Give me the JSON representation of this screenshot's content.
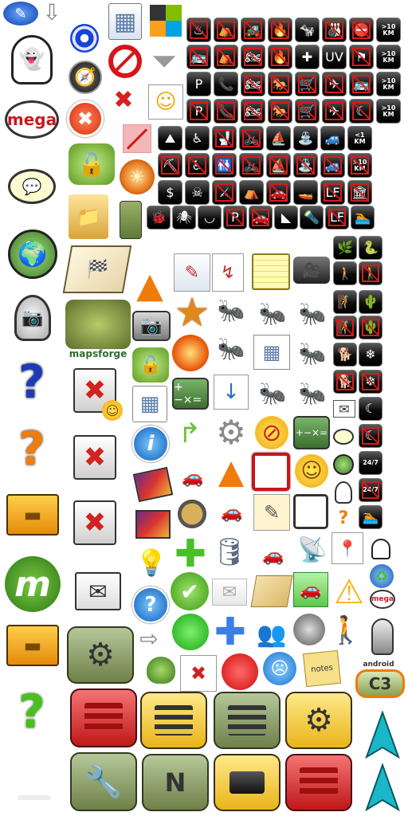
{
  "sheet": {
    "background": "#ffffff"
  },
  "labels": {
    "mega": "mega",
    "mapsforge": "mapsforge",
    "km": "KM",
    "km_prefix_10": ">10",
    "km_prefix_1": "<1",
    "uv": "UV",
    "hours": "24/7",
    "notes": "notes",
    "android": "android",
    "c3": "C3"
  },
  "icons": [
    {
      "name": "geocaching-pen-icon",
      "glyph": "✎"
    },
    {
      "name": "arrow-down-icon",
      "glyph": "⇩"
    },
    {
      "name": "ghost-icon",
      "glyph": "👻"
    },
    {
      "name": "target-icon",
      "glyph": "◎"
    },
    {
      "name": "calculator-list-icon",
      "glyph": "▦"
    },
    {
      "name": "geocaching-logo-icon",
      "glyph": "◩"
    },
    {
      "name": "compass-icon",
      "glyph": "🧭"
    },
    {
      "name": "no-entry-icon",
      "glyph": "⛔"
    },
    {
      "name": "filter-funnel-icon",
      "glyph": "⏷"
    },
    {
      "name": "close-circle-icon",
      "glyph": "✖"
    },
    {
      "name": "red-x-icon",
      "glyph": "✖"
    },
    {
      "name": "note-smiley-icon",
      "glyph": "☺"
    },
    {
      "name": "chat-bubble-icon",
      "glyph": "💬"
    },
    {
      "name": "unlock-icon",
      "glyph": "🔓"
    },
    {
      "name": "red-strike-icon",
      "glyph": "⧄"
    },
    {
      "name": "sun-fire-icon",
      "glyph": "☀"
    },
    {
      "name": "world-map-icon",
      "glyph": "🌍"
    },
    {
      "name": "folder-icon",
      "glyph": "📁"
    },
    {
      "name": "green-card-icon",
      "glyph": "▮"
    },
    {
      "name": "webcam-icon",
      "glyph": "📷"
    },
    {
      "name": "question-blue-icon",
      "glyph": "?"
    },
    {
      "name": "question-orange-icon",
      "glyph": "?"
    },
    {
      "name": "question-green-icon",
      "glyph": "?"
    },
    {
      "name": "orange-boxes-icon",
      "glyph": "▬"
    },
    {
      "name": "m-logo-icon",
      "glyph": "m"
    },
    {
      "name": "envelope-icon",
      "glyph": "✉"
    },
    {
      "name": "gear-icon",
      "glyph": "⚙"
    },
    {
      "name": "arrow-right-icon",
      "glyph": "⇨"
    },
    {
      "name": "map-flag-icon",
      "glyph": "🏁"
    },
    {
      "name": "traffic-cone-icon",
      "glyph": "▲"
    },
    {
      "name": "star-icon",
      "glyph": "★"
    },
    {
      "name": "camera-icon",
      "glyph": "📷"
    },
    {
      "name": "camcorder-icon",
      "glyph": "🎥"
    },
    {
      "name": "notepad-icon",
      "glyph": "📒"
    },
    {
      "name": "info-icon",
      "glyph": "i"
    },
    {
      "name": "plus-icon",
      "glyph": "✚"
    },
    {
      "name": "database-gear-icon",
      "glyph": "🛢"
    },
    {
      "name": "lightbulb-icon",
      "glyph": "💡"
    },
    {
      "name": "check-icon",
      "glyph": "✔"
    },
    {
      "name": "green-dot-icon",
      "glyph": "●"
    },
    {
      "name": "blue-cross-icon",
      "glyph": "✚"
    },
    {
      "name": "people-icon",
      "glyph": "👥"
    },
    {
      "name": "moon-icon",
      "glyph": "●"
    },
    {
      "name": "walker-icon",
      "glyph": "🚶"
    },
    {
      "name": "microphone-icon",
      "glyph": "🎤"
    },
    {
      "name": "red-dot-icon",
      "glyph": "●"
    },
    {
      "name": "smiley-icon",
      "glyph": "☺"
    },
    {
      "name": "warning-icon",
      "glyph": "⚠"
    },
    {
      "name": "satellite-dish-icon",
      "glyph": "📡"
    },
    {
      "name": "car-icon",
      "glyph": "🚗"
    },
    {
      "name": "recycle-icon",
      "glyph": "♻"
    },
    {
      "name": "map-pin-icon",
      "glyph": "📍"
    },
    {
      "name": "green-arrow-up-icon",
      "glyph": "▲"
    },
    {
      "name": "cyan-arrow-up-icon",
      "glyph": "▲"
    },
    {
      "name": "wrench-screwdriver-icon",
      "glyph": "🔧"
    },
    {
      "name": "navi-icon",
      "glyph": "N"
    }
  ],
  "attribute_glyphs": [
    "♨",
    "⛺",
    "🚜",
    "🔥",
    "🐄",
    "🎳",
    "⛔",
    "10",
    "🚌",
    "⛺",
    "🏍",
    "🔥",
    "✚",
    "UV",
    "⚑",
    "10",
    "P",
    "📞",
    "🏍",
    "🐎",
    "🛒",
    "✈",
    "🚌",
    "10",
    "P",
    "📞",
    "🏍",
    "🐎",
    "🛒",
    "✈",
    "☾",
    "10",
    "⛰",
    "♿",
    "🚽",
    "🚲",
    "⛵",
    "⛲",
    "🚙",
    "1",
    "⛏",
    "♿",
    "🚻",
    "🚲",
    "⛵",
    "⛲",
    "🚙",
    "10",
    "$",
    "☠",
    "⚔",
    "⛺",
    "🚗",
    "🚤",
    "LF",
    "🏛"
  ]
}
